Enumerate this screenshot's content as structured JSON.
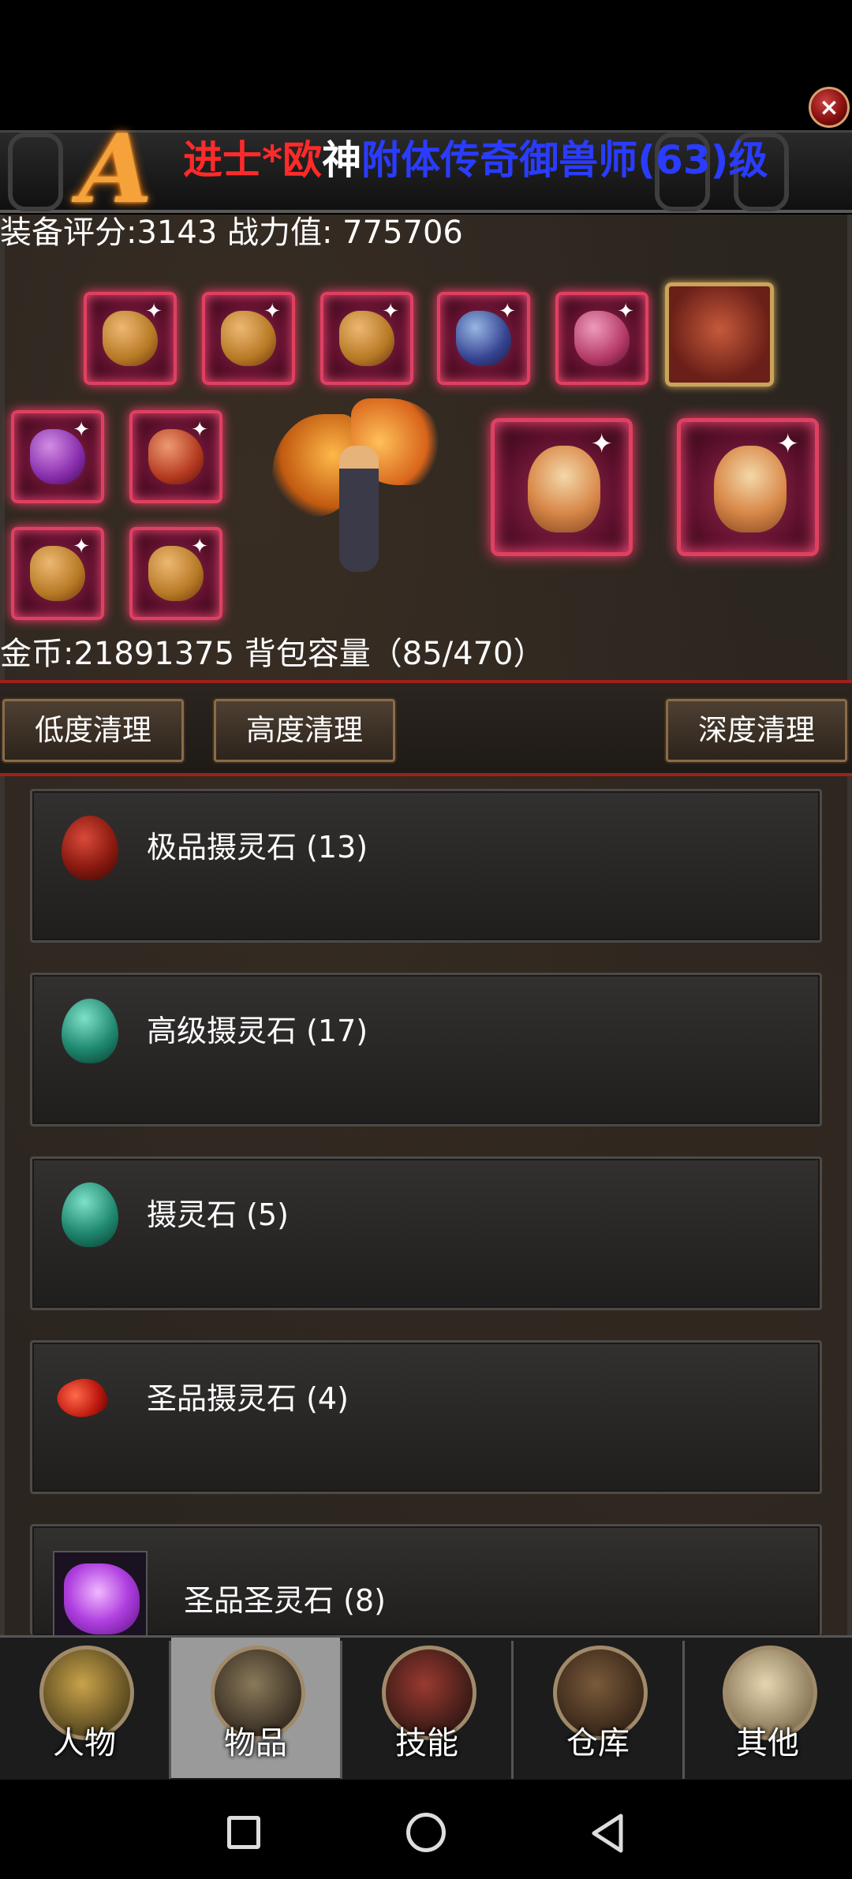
{
  "title": {
    "logo": "A",
    "part_red": "进士*欧",
    "part_white": "神",
    "part_blue": "附体传奇御兽师(63)级"
  },
  "close_icon": "×",
  "stats": {
    "text": "装备评分:3143 战力值:  775706"
  },
  "inventory": {
    "text": "金币:21891375 背包容量（85/470）"
  },
  "buttons": {
    "low": "低度清理",
    "high": "高度清理",
    "deep": "深度清理"
  },
  "items": [
    {
      "name": "极品摄灵石 (13)",
      "icon": "red-stone-icon"
    },
    {
      "name": "高级摄灵石 (17)",
      "icon": "green-stone-icon"
    },
    {
      "name": "摄灵石 (5)",
      "icon": "green-stone-icon"
    },
    {
      "name": "圣品摄灵石 (4)",
      "icon": "red-flake-icon"
    },
    {
      "name": "圣品圣灵石 (8)",
      "icon": "purple-stone-icon"
    }
  ],
  "nav": [
    {
      "label": "人物",
      "active": false
    },
    {
      "label": "物品",
      "active": true
    },
    {
      "label": "技能",
      "active": false
    },
    {
      "label": "仓库",
      "active": false
    },
    {
      "label": "其他",
      "active": false
    }
  ],
  "colors": {
    "title_red": "#ff2a2a",
    "title_blue": "#2a3cff",
    "divider_red": "#a0201a",
    "active_tab": "#9a9a9a"
  }
}
